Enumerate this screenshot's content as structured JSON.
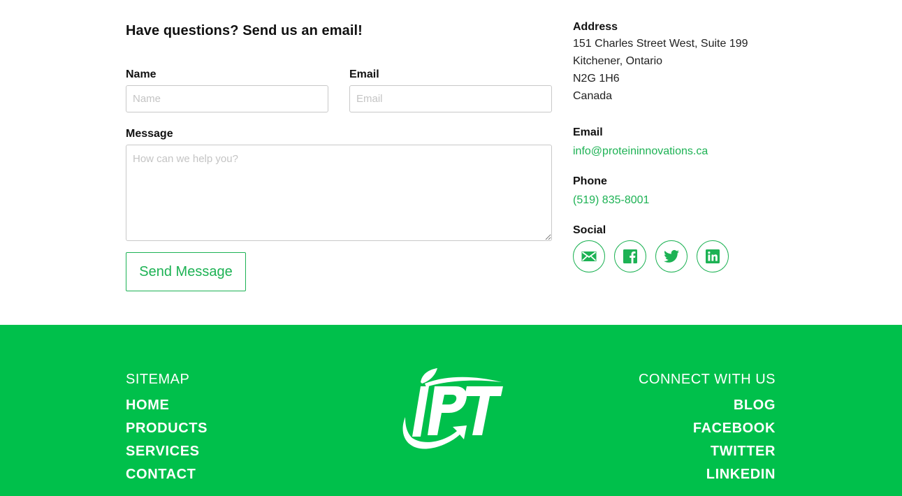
{
  "form": {
    "title": "Have questions? Send us an email!",
    "name_label": "Name",
    "name_placeholder": "Name",
    "name_value": "",
    "email_label": "Email",
    "email_placeholder": "Email",
    "email_value": "",
    "message_label": "Message",
    "message_placeholder": "How can we help you?",
    "message_value": "",
    "submit_label": "Send Message"
  },
  "contact_info": {
    "address_heading": "Address",
    "address_lines": [
      "151 Charles Street West, Suite 199",
      "Kitchener, Ontario",
      "N2G 1H6",
      "Canada"
    ],
    "email_heading": "Email",
    "email": "info@proteininnovations.ca",
    "phone_heading": "Phone",
    "phone": "(519) 835-8001",
    "social_heading": "Social",
    "social_icons": [
      "email-icon",
      "facebook-icon",
      "twitter-icon",
      "linkedin-icon"
    ]
  },
  "footer": {
    "sitemap_heading": "SITEMAP",
    "sitemap_links": [
      "HOME",
      "PRODUCTS",
      "SERVICES",
      "CONTACT"
    ],
    "connect_heading": "CONNECT WITH US",
    "connect_links": [
      "BLOG",
      "FACEBOOK",
      "TWITTER",
      "LINKEDIN"
    ],
    "logo_text": "IPT"
  },
  "colors": {
    "accent_green": "#1db254",
    "footer_green": "#00c04b",
    "text_dark": "#111111",
    "input_border": "#c8c8c8"
  }
}
